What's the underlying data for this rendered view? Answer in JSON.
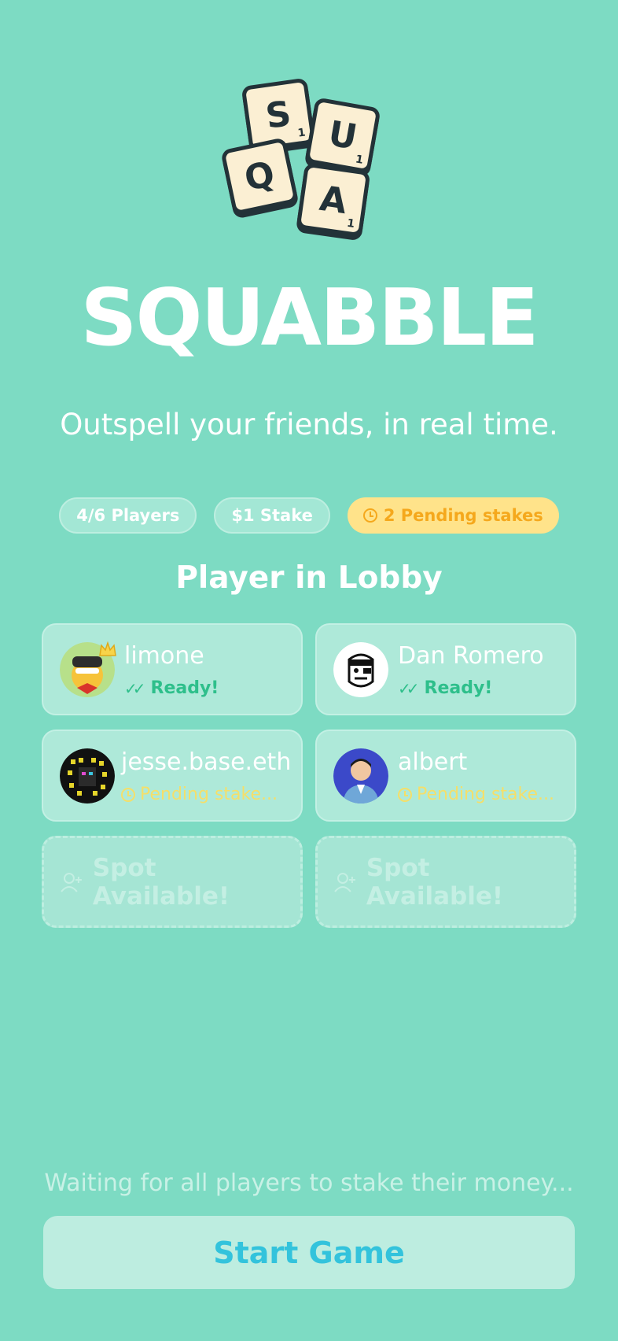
{
  "app": {
    "title": "SQUABBLE",
    "tagline": "Outspell your friends, in real time.",
    "logo_tiles": [
      {
        "letter": "S",
        "points": "1"
      },
      {
        "letter": "U",
        "points": "1"
      },
      {
        "letter": "Q",
        "points": ""
      },
      {
        "letter": "A",
        "points": "1"
      }
    ]
  },
  "badges": {
    "players": "4/6 Players",
    "stake": "$1 Stake",
    "pending": "2 Pending stakes"
  },
  "lobby": {
    "heading": "Player in Lobby",
    "players": [
      {
        "name": "limone",
        "status": "Ready!",
        "state": "ready",
        "host": true
      },
      {
        "name": "Dan Romero",
        "status": "Ready!",
        "state": "ready",
        "host": false
      },
      {
        "name": "jesse.base.eth",
        "status": "Pending stake...",
        "state": "pending",
        "host": false
      },
      {
        "name": "albert",
        "status": "Pending stake...",
        "state": "pending",
        "host": false
      }
    ],
    "empty_slots": [
      {
        "label": "Spot Available!"
      },
      {
        "label": "Spot Available!"
      }
    ]
  },
  "footer": {
    "waiting_text": "Waiting for all players to stake their money...",
    "start_button": "Start Game"
  },
  "colors": {
    "background": "#7ddbc3",
    "ready": "#2ebf8b",
    "pending": "#f5df69",
    "pending_badge_bg": "#ffe38a",
    "start_text": "#33c3dc"
  }
}
